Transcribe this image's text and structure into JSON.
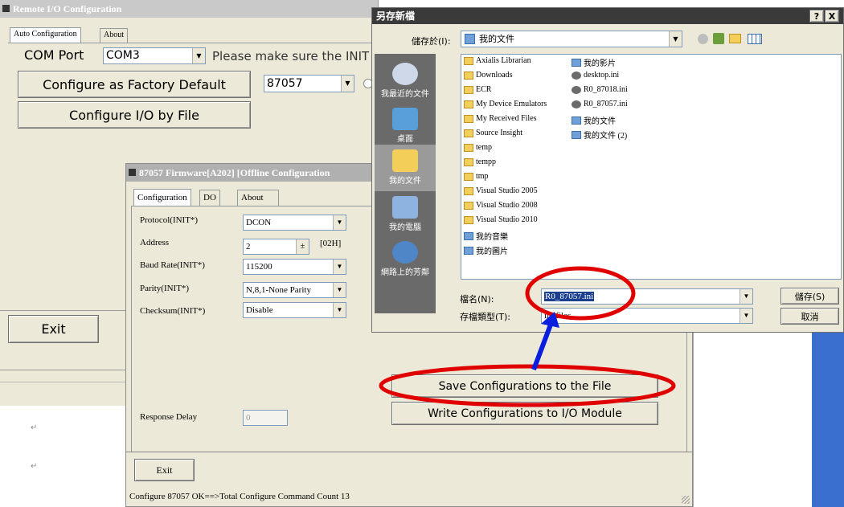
{
  "remote": {
    "title": "Remote I/O Configuration",
    "tabs": [
      "Auto Configuration",
      "About"
    ],
    "com_label": "COM Port",
    "com_value": "COM3",
    "hint": "Please make sure the INIT",
    "btn_factory": "Configure as Factory Default",
    "module_value": "87057",
    "btn_byfile": "Configure I/O by File",
    "btn_exit": "Exit"
  },
  "firmware": {
    "title": "87057 Firmware[A202] [Offline Configuration",
    "tabs": [
      "Configuration",
      "DO",
      "About"
    ],
    "fields": [
      {
        "label": "Protocol(INIT*)",
        "value": "DCON"
      },
      {
        "label": "Address",
        "value": "2",
        "extra": "[02H]"
      },
      {
        "label": "Baud Rate(INIT*)",
        "value": "115200"
      },
      {
        "label": "Parity(INIT*)",
        "value": "N,8,1-None Parity"
      },
      {
        "label": "Checksum(INIT*)",
        "value": "Disable"
      }
    ],
    "response_label": "Response Delay",
    "response_value": "0",
    "btn_save": "Save Configurations to the File",
    "btn_write": "Write Configurations to I/O Module",
    "btn_exit": "Exit",
    "status": "Configure 87057 OK==>Total Configure Command Count 13"
  },
  "dialog": {
    "title": "另存新檔",
    "help": "?",
    "close": "X",
    "savein_label": "儲存於(I):",
    "savein_value": "我的文件",
    "places": [
      "我最近的文件",
      "桌面",
      "我的文件",
      "我的電腦",
      "網路上的芳鄰"
    ],
    "files_col1": [
      "Axialis Librarian",
      "Downloads",
      "ECR",
      "My Device Emulators",
      "My Received Files",
      "Source Insight",
      "temp",
      "tempp",
      "tmp",
      "Visual Studio 2005",
      "Visual Studio 2008",
      "Visual Studio 2010",
      "我的音樂",
      "我的圖片"
    ],
    "files_col2": [
      "我的影片",
      "desktop.ini",
      "R0_87018.ini",
      "R0_87057.ini",
      "我的文件",
      "我的文件 (2)"
    ],
    "filename_label": "檔名(N):",
    "filename_value": "R0_87057.ini",
    "filetype_label": "存檔類型(T):",
    "filetype_value": "ini files",
    "btn_save": "儲存(S)",
    "btn_cancel": "取消"
  },
  "colors": {
    "highlight": "#e00000",
    "arrow": "#0a1ee0",
    "dialog_sidebar": "#6a6a6a",
    "title_blue": "#3a6fcf"
  }
}
